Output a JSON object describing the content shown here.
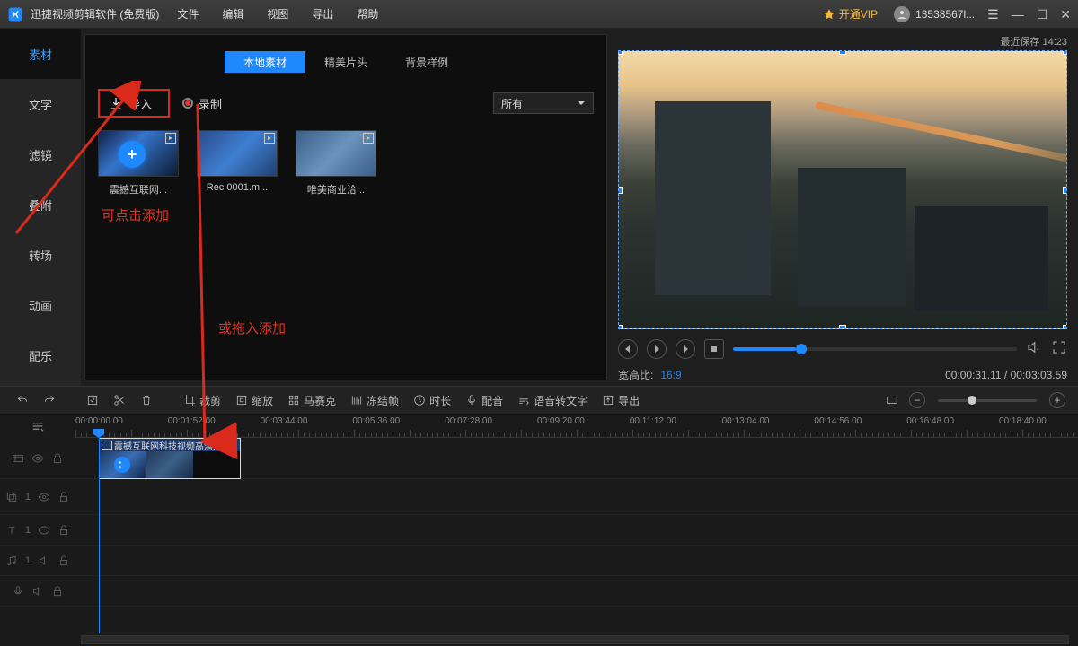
{
  "titlebar": {
    "app_title": "迅捷视频剪辑软件 (免费版)",
    "menus": [
      "文件",
      "编辑",
      "视图",
      "导出",
      "帮助"
    ],
    "vip_label": "开通VIP",
    "username": "13538567l...",
    "last_save_label": "最近保存 14:23"
  },
  "sidebar": {
    "items": [
      {
        "label": "素材"
      },
      {
        "label": "文字"
      },
      {
        "label": "滤镜"
      },
      {
        "label": "叠附"
      },
      {
        "label": "转场"
      },
      {
        "label": "动画"
      },
      {
        "label": "配乐"
      }
    ]
  },
  "media_panel": {
    "tabs": [
      {
        "label": "本地素材"
      },
      {
        "label": "精美片头"
      },
      {
        "label": "背景样例"
      }
    ],
    "import_label": "导入",
    "record_label": "录制",
    "category_selected": "所有",
    "annot_click": "可点击添加",
    "annot_drag": "或拖入添加",
    "thumbs": [
      {
        "label": "震撼互联网..."
      },
      {
        "label": "Rec 0001.m..."
      },
      {
        "label": "唯美商业洽..."
      }
    ]
  },
  "preview": {
    "ratio_label": "宽高比:",
    "ratio_value": "16:9",
    "time_current": "00:00:31.11",
    "time_total": "00:03:03.59"
  },
  "toolbar": {
    "btns": [
      {
        "label": "",
        "icon": "undo"
      },
      {
        "label": "",
        "icon": "redo"
      },
      {
        "label": "",
        "icon": "crop"
      },
      {
        "label": "",
        "icon": "scissors"
      },
      {
        "label": "",
        "icon": "trash"
      },
      {
        "label": "裁剪",
        "icon": "cut"
      },
      {
        "label": "缩放",
        "icon": "zoom"
      },
      {
        "label": "马赛克",
        "icon": "mosaic"
      },
      {
        "label": "冻结帧",
        "icon": "freeze"
      },
      {
        "label": "时长",
        "icon": "clock"
      },
      {
        "label": "配音",
        "icon": "mic"
      },
      {
        "label": "语音转文字",
        "icon": "speech"
      },
      {
        "label": "导出",
        "icon": "export"
      }
    ]
  },
  "timeline": {
    "ruler": [
      "00:00:00.00",
      "00:01:52.00",
      "00:03:44.00",
      "00:05:36.00",
      "00:07:28.00",
      "00:09:20.00",
      "00:11:12.00",
      "00:13:04.00",
      "00:14:56.00",
      "00:16:48.00",
      "00:18:40.00"
    ],
    "clip_label": "震撼互联网科技视频高清...",
    "track_labels": {
      "t2": "1",
      "t3": "1",
      "t4": "1"
    }
  }
}
